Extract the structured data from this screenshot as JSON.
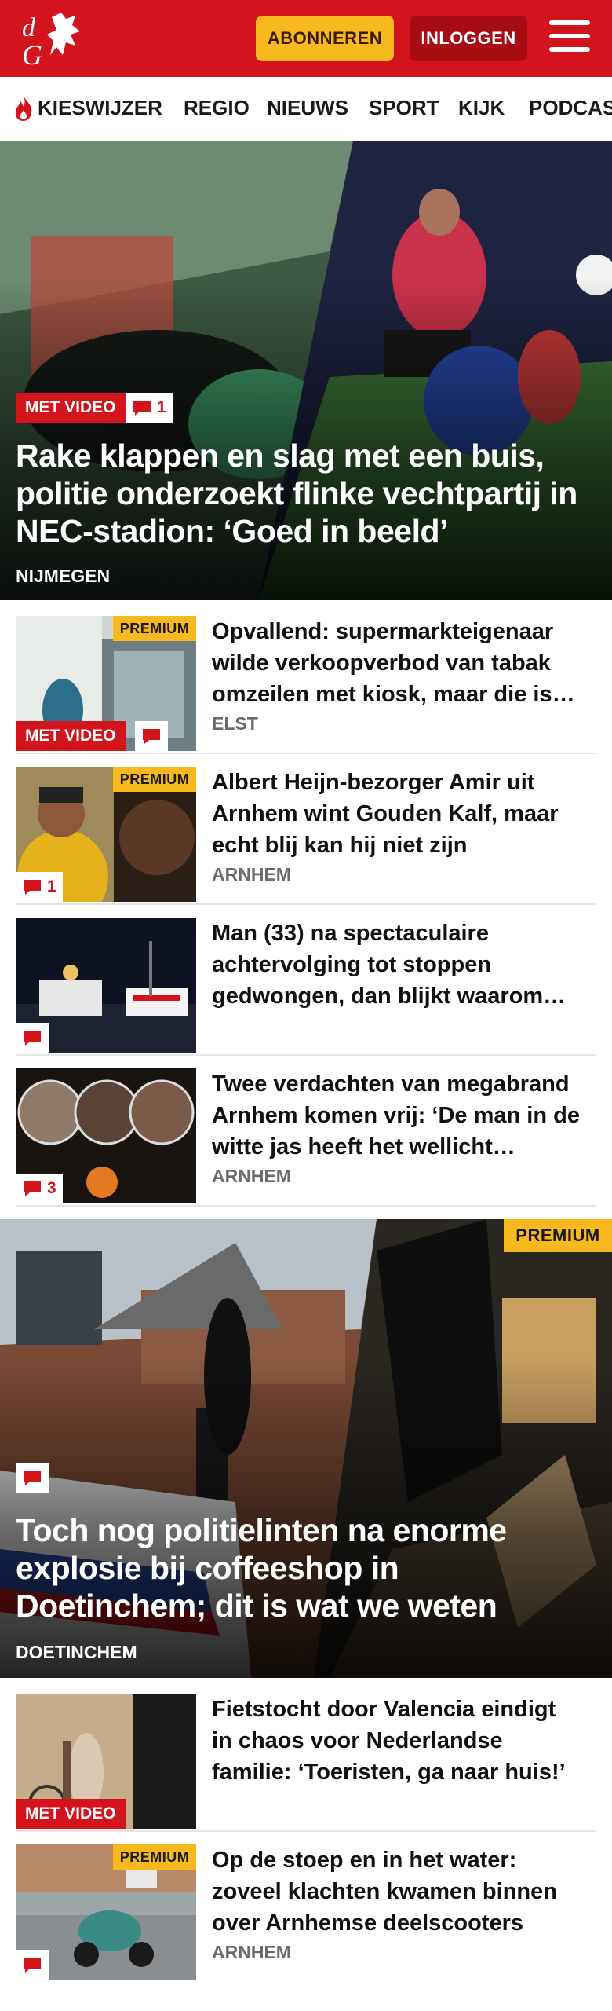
{
  "header": {
    "subscribe_label": "ABONNEREN",
    "login_label": "INLOGGEN"
  },
  "nav": {
    "items": [
      "KIESWIJZER",
      "REGIO",
      "NIEUWS",
      "SPORT",
      "KIJK",
      "PODCAST"
    ]
  },
  "colors": {
    "brand_red": "#d3141c",
    "premium_yellow": "#f7b91e",
    "login_dark_red": "#a80d14"
  },
  "hero1": {
    "badge_video": "MET VIDEO",
    "comments": "1",
    "title": "Rake klappen en slag met een buis, politie onderzoekt flinke vechtpartij in NEC-stadion: ‘Goed in beeld’",
    "region": "NIJMEGEN"
  },
  "list1": [
    {
      "premium": "PREMIUM",
      "badge_video": "MET VIDEO",
      "comments": "",
      "title": "Opvallend: supermarkteigenaar wilde verkoopverbod van tabak omzeilen met kiosk, maar die is…",
      "region": "ELST"
    },
    {
      "premium": "PREMIUM",
      "comments": "1",
      "title": "Albert Heijn-bezorger Amir uit Arnhem wint Gouden Kalf, maar echt blij kan hij niet zijn",
      "region": "ARNHEM"
    },
    {
      "comments": "",
      "title": "Man (33) na spectaculaire achtervolging tot stoppen gedwongen, dan blijkt waarom…",
      "region": ""
    },
    {
      "comments": "3",
      "title": "Twee verdachten van megabrand Arnhem komen vrij: ‘De man in de witte jas heeft het wellicht…",
      "region": "ARNHEM"
    }
  ],
  "hero2": {
    "premium": "PREMIUM",
    "title": "Toch nog politielinten na enorme explosie bij coffeeshop in Doetinchem; dit is wat we weten",
    "region": "DOETINCHEM"
  },
  "list2": [
    {
      "badge_video": "MET VIDEO",
      "title": "Fietstocht door Valencia eindigt in chaos voor Nederlandse familie: ‘Toeristen, ga naar huis!’",
      "region": ""
    },
    {
      "premium": "PREMIUM",
      "comments": "",
      "title": "Op de stoep en in het water: zoveel klachten kwamen binnen over Arnhemse deelscooters",
      "region": "ARNHEM"
    }
  ]
}
